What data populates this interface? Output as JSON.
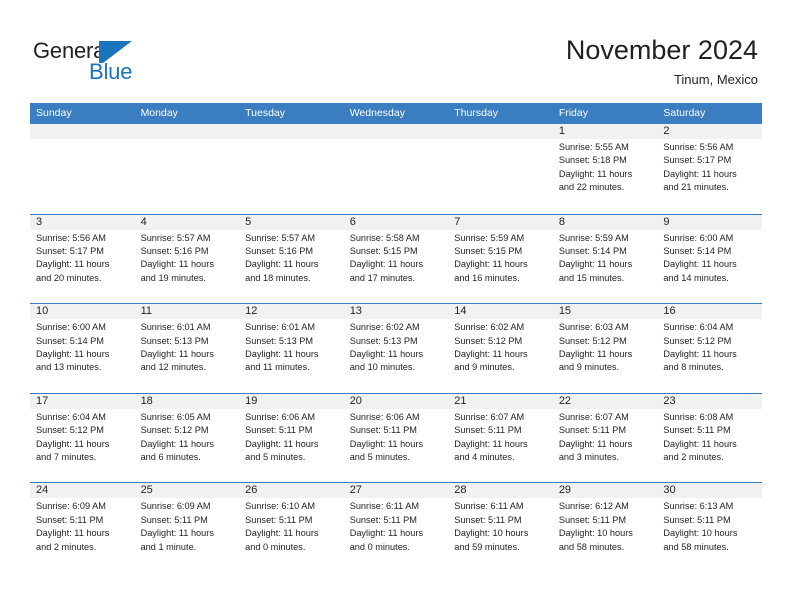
{
  "logo": {
    "text_primary": "General",
    "text_secondary": "Blue",
    "mark_name": "generalblue-triangle-logo",
    "color_primary": "#231f20",
    "color_secondary": "#1b75bb"
  },
  "header": {
    "month_title": "November 2024",
    "location": "Tinum, Mexico"
  },
  "theme": {
    "header_blue": "#3a7dc0",
    "daynum_band": "#f1f1f1",
    "text": "#231f20",
    "page_background": "#ffffff"
  },
  "calendar": {
    "weekdays": [
      "Sunday",
      "Monday",
      "Tuesday",
      "Wednesday",
      "Thursday",
      "Friday",
      "Saturday"
    ],
    "weeks": [
      [
        {
          "day": "",
          "empty": true
        },
        {
          "day": "",
          "empty": true
        },
        {
          "day": "",
          "empty": true
        },
        {
          "day": "",
          "empty": true
        },
        {
          "day": "",
          "empty": true
        },
        {
          "day": "1",
          "sunrise": "Sunrise: 5:55 AM",
          "sunset": "Sunset: 5:18 PM",
          "daylight_line1": "Daylight: 11 hours",
          "daylight_line2": "and 22 minutes."
        },
        {
          "day": "2",
          "sunrise": "Sunrise: 5:56 AM",
          "sunset": "Sunset: 5:17 PM",
          "daylight_line1": "Daylight: 11 hours",
          "daylight_line2": "and 21 minutes."
        }
      ],
      [
        {
          "day": "3",
          "sunrise": "Sunrise: 5:56 AM",
          "sunset": "Sunset: 5:17 PM",
          "daylight_line1": "Daylight: 11 hours",
          "daylight_line2": "and 20 minutes."
        },
        {
          "day": "4",
          "sunrise": "Sunrise: 5:57 AM",
          "sunset": "Sunset: 5:16 PM",
          "daylight_line1": "Daylight: 11 hours",
          "daylight_line2": "and 19 minutes."
        },
        {
          "day": "5",
          "sunrise": "Sunrise: 5:57 AM",
          "sunset": "Sunset: 5:16 PM",
          "daylight_line1": "Daylight: 11 hours",
          "daylight_line2": "and 18 minutes."
        },
        {
          "day": "6",
          "sunrise": "Sunrise: 5:58 AM",
          "sunset": "Sunset: 5:15 PM",
          "daylight_line1": "Daylight: 11 hours",
          "daylight_line2": "and 17 minutes."
        },
        {
          "day": "7",
          "sunrise": "Sunrise: 5:59 AM",
          "sunset": "Sunset: 5:15 PM",
          "daylight_line1": "Daylight: 11 hours",
          "daylight_line2": "and 16 minutes."
        },
        {
          "day": "8",
          "sunrise": "Sunrise: 5:59 AM",
          "sunset": "Sunset: 5:14 PM",
          "daylight_line1": "Daylight: 11 hours",
          "daylight_line2": "and 15 minutes."
        },
        {
          "day": "9",
          "sunrise": "Sunrise: 6:00 AM",
          "sunset": "Sunset: 5:14 PM",
          "daylight_line1": "Daylight: 11 hours",
          "daylight_line2": "and 14 minutes."
        }
      ],
      [
        {
          "day": "10",
          "sunrise": "Sunrise: 6:00 AM",
          "sunset": "Sunset: 5:14 PM",
          "daylight_line1": "Daylight: 11 hours",
          "daylight_line2": "and 13 minutes."
        },
        {
          "day": "11",
          "sunrise": "Sunrise: 6:01 AM",
          "sunset": "Sunset: 5:13 PM",
          "daylight_line1": "Daylight: 11 hours",
          "daylight_line2": "and 12 minutes."
        },
        {
          "day": "12",
          "sunrise": "Sunrise: 6:01 AM",
          "sunset": "Sunset: 5:13 PM",
          "daylight_line1": "Daylight: 11 hours",
          "daylight_line2": "and 11 minutes."
        },
        {
          "day": "13",
          "sunrise": "Sunrise: 6:02 AM",
          "sunset": "Sunset: 5:13 PM",
          "daylight_line1": "Daylight: 11 hours",
          "daylight_line2": "and 10 minutes."
        },
        {
          "day": "14",
          "sunrise": "Sunrise: 6:02 AM",
          "sunset": "Sunset: 5:12 PM",
          "daylight_line1": "Daylight: 11 hours",
          "daylight_line2": "and 9 minutes."
        },
        {
          "day": "15",
          "sunrise": "Sunrise: 6:03 AM",
          "sunset": "Sunset: 5:12 PM",
          "daylight_line1": "Daylight: 11 hours",
          "daylight_line2": "and 9 minutes."
        },
        {
          "day": "16",
          "sunrise": "Sunrise: 6:04 AM",
          "sunset": "Sunset: 5:12 PM",
          "daylight_line1": "Daylight: 11 hours",
          "daylight_line2": "and 8 minutes."
        }
      ],
      [
        {
          "day": "17",
          "sunrise": "Sunrise: 6:04 AM",
          "sunset": "Sunset: 5:12 PM",
          "daylight_line1": "Daylight: 11 hours",
          "daylight_line2": "and 7 minutes."
        },
        {
          "day": "18",
          "sunrise": "Sunrise: 6:05 AM",
          "sunset": "Sunset: 5:12 PM",
          "daylight_line1": "Daylight: 11 hours",
          "daylight_line2": "and 6 minutes."
        },
        {
          "day": "19",
          "sunrise": "Sunrise: 6:06 AM",
          "sunset": "Sunset: 5:11 PM",
          "daylight_line1": "Daylight: 11 hours",
          "daylight_line2": "and 5 minutes."
        },
        {
          "day": "20",
          "sunrise": "Sunrise: 6:06 AM",
          "sunset": "Sunset: 5:11 PM",
          "daylight_line1": "Daylight: 11 hours",
          "daylight_line2": "and 5 minutes."
        },
        {
          "day": "21",
          "sunrise": "Sunrise: 6:07 AM",
          "sunset": "Sunset: 5:11 PM",
          "daylight_line1": "Daylight: 11 hours",
          "daylight_line2": "and 4 minutes."
        },
        {
          "day": "22",
          "sunrise": "Sunrise: 6:07 AM",
          "sunset": "Sunset: 5:11 PM",
          "daylight_line1": "Daylight: 11 hours",
          "daylight_line2": "and 3 minutes."
        },
        {
          "day": "23",
          "sunrise": "Sunrise: 6:08 AM",
          "sunset": "Sunset: 5:11 PM",
          "daylight_line1": "Daylight: 11 hours",
          "daylight_line2": "and 2 minutes."
        }
      ],
      [
        {
          "day": "24",
          "sunrise": "Sunrise: 6:09 AM",
          "sunset": "Sunset: 5:11 PM",
          "daylight_line1": "Daylight: 11 hours",
          "daylight_line2": "and 2 minutes."
        },
        {
          "day": "25",
          "sunrise": "Sunrise: 6:09 AM",
          "sunset": "Sunset: 5:11 PM",
          "daylight_line1": "Daylight: 11 hours",
          "daylight_line2": "and 1 minute."
        },
        {
          "day": "26",
          "sunrise": "Sunrise: 6:10 AM",
          "sunset": "Sunset: 5:11 PM",
          "daylight_line1": "Daylight: 11 hours",
          "daylight_line2": "and 0 minutes."
        },
        {
          "day": "27",
          "sunrise": "Sunrise: 6:11 AM",
          "sunset": "Sunset: 5:11 PM",
          "daylight_line1": "Daylight: 11 hours",
          "daylight_line2": "and 0 minutes."
        },
        {
          "day": "28",
          "sunrise": "Sunrise: 6:11 AM",
          "sunset": "Sunset: 5:11 PM",
          "daylight_line1": "Daylight: 10 hours",
          "daylight_line2": "and 59 minutes."
        },
        {
          "day": "29",
          "sunrise": "Sunrise: 6:12 AM",
          "sunset": "Sunset: 5:11 PM",
          "daylight_line1": "Daylight: 10 hours",
          "daylight_line2": "and 58 minutes."
        },
        {
          "day": "30",
          "sunrise": "Sunrise: 6:13 AM",
          "sunset": "Sunset: 5:11 PM",
          "daylight_line1": "Daylight: 10 hours",
          "daylight_line2": "and 58 minutes."
        }
      ]
    ]
  }
}
